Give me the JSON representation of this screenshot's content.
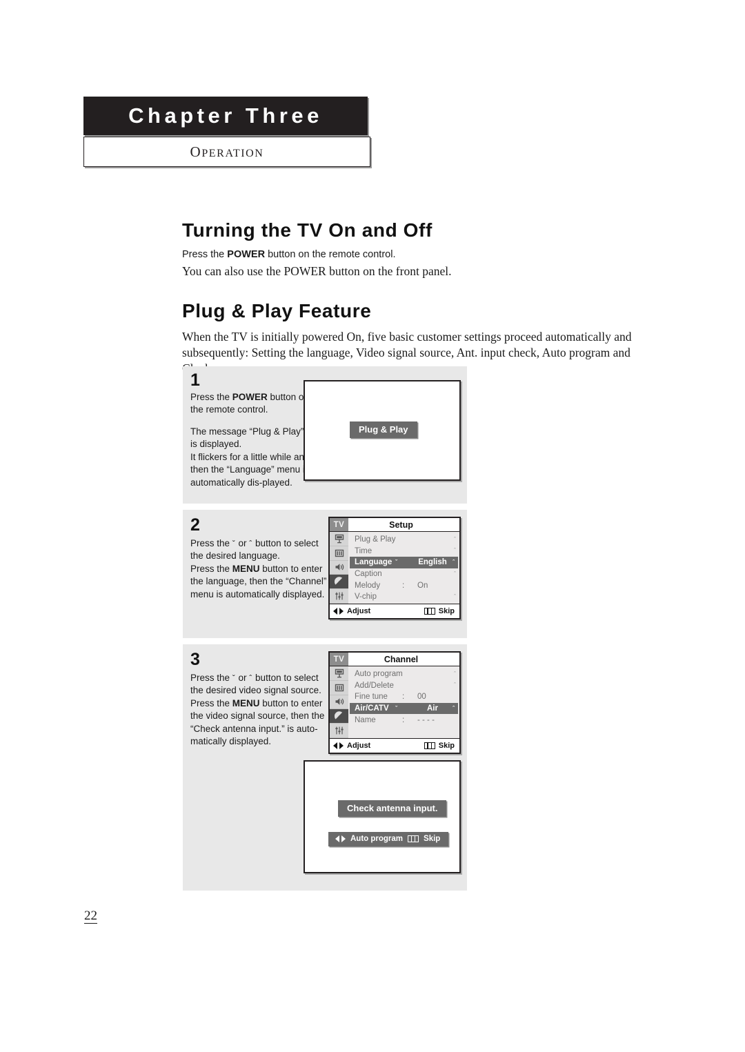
{
  "chapter": {
    "title": "Chapter Three",
    "subtitle_cap": "O",
    "subtitle_rest": "PERATION"
  },
  "sections": [
    {
      "heading": "Turning the TV On and Off",
      "line_sans_pre": "Press the ",
      "line_sans_bold": "POWER",
      "line_sans_post": " button on the remote control.",
      "line_serif": "You can also use the POWER button on the front panel."
    },
    {
      "heading": "Plug & Play Feature",
      "paragraph": "When the TV is initially powered On, five basic customer settings proceed automatically and subsequently: Setting the language, Video signal source, Ant. input check, Auto program and Clock."
    }
  ],
  "steps": [
    {
      "number": "1",
      "text_1_pre": "Press the ",
      "text_1_bold": "POWER",
      "text_1_post": " button on the remote control.",
      "text_2": "The message “Plug & Play” is displayed.",
      "text_3": "It flickers for a little while and then the “Language” menu is automatically dis-played.",
      "screen_banner": "Plug & Play"
    },
    {
      "number": "2",
      "text_1_pre": "Press the ",
      "text_1_down": "ˇ",
      "text_1_mid": " or ",
      "text_1_up": "ˆ",
      "text_1_post": " button to select the desired language.",
      "text_2_pre": "Press the ",
      "text_2_bold": "MENU",
      "text_2_post": " button to enter the language, then the “Channel” menu is automatically displayed."
    },
    {
      "number": "3",
      "text_1_pre": "Press the ",
      "text_1_down": "ˇ",
      "text_1_mid": " or ",
      "text_1_up": "ˆ",
      "text_1_post": " button to select the desired video signal source.",
      "text_2_pre": "Press the ",
      "text_2_bold": "MENU",
      "text_2_post": " button to enter the video signal source, then the “Check antenna input.” is auto-matically displayed.",
      "screen_banner": "Check antenna input.",
      "screen_bar_label": "Auto program",
      "screen_bar_skip": "Skip"
    }
  ],
  "setup_menu": {
    "tv_tab": "TV",
    "title": "Setup",
    "rail_icons": [
      "tv-tab",
      "picture-icon",
      "channel-bars-icon",
      "sound-speaker-icon",
      "antenna-dish-icon",
      "setup-sliders-icon"
    ],
    "active_rail_index": 4,
    "rows": [
      {
        "label": "Plug & Play",
        "colon": "",
        "value": "",
        "caret": "ˆ",
        "highlight": false
      },
      {
        "label": "Time",
        "colon": "",
        "value": "",
        "caret": "ˆ",
        "highlight": false
      },
      {
        "label": "Language",
        "colon": "",
        "value": "English",
        "caret": "ˆ",
        "tri_left": "ˇ",
        "highlight": true
      },
      {
        "label": "Caption",
        "colon": "",
        "value": "",
        "caret": "ˆ",
        "highlight": false
      },
      {
        "label": "Melody",
        "colon": ":",
        "value": "On",
        "caret": "",
        "highlight": false
      },
      {
        "label": "V-chip",
        "colon": "",
        "value": "",
        "caret": "ˆ",
        "highlight": false
      }
    ],
    "footer_adjust": "Adjust",
    "footer_skip": "Skip"
  },
  "channel_menu": {
    "tv_tab": "TV",
    "title": "Channel",
    "active_rail_index": 3,
    "rows": [
      {
        "label": "Auto program",
        "colon": "",
        "value": "",
        "caret": "ˆ",
        "highlight": false
      },
      {
        "label": "Add/Delete",
        "colon": "",
        "value": "",
        "caret": "ˆ",
        "highlight": false
      },
      {
        "label": "Fine tune",
        "colon": ":",
        "value": "00",
        "caret": "",
        "highlight": false
      },
      {
        "label": "Air/CATV",
        "colon": "",
        "value": "Air",
        "caret": "ˆ",
        "tri_left": "ˇ",
        "highlight": true
      },
      {
        "label": "Name",
        "colon": ":",
        "value": "- - - -",
        "caret": "",
        "highlight": false
      }
    ],
    "footer_adjust": "Adjust",
    "footer_skip": "Skip"
  },
  "page_number": "22"
}
